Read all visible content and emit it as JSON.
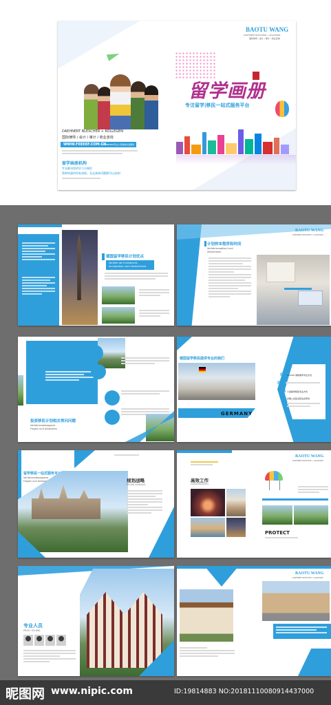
{
  "cover": {
    "brand": "BAOTU WANG",
    "brand_sub": "DAEHNERT BLESCHER + KOLLEGEN",
    "brand_tagline": "国际律师 / 会计 / 审计 / 商业咨询",
    "title": "留学画册",
    "subtitle": "专注留学|移民一站式服务平台",
    "company": "DAEHNERT BLESCHER + KOLLEGEN",
    "services": "国际律师 / 会计 / 审计 / 商业咨询",
    "url": "WWW.FEEEEF.COM.CN",
    "hotline": "400888888专业人员竭诚为您服务",
    "org_title": "留学画册机构",
    "org_line1": "专业解决您的学习与移民",
    "org_line2": "简单快速的所有流程，无论具体问题都可以咨询！"
  },
  "spread1": {
    "left_title": "德国留学移民计划优点",
    "left_sub1": "Vorteile der Investment-",
    "left_sub2": "Immigration nach Deutschland",
    "right_brand": "BAOTU WANG",
    "right_brand_sub": "DAEHNERT BLESCHER + KOLLEGEN",
    "right_title": "计划样本程序和时间",
    "right_sub1": "Verfahrensablauf und",
    "right_sub2": "Zeitrahmen"
  },
  "spread2": {
    "left_title": "投资移民计划相关常问问题",
    "left_sub1": "Verfahrensbezogene",
    "left_sub2": "Fragen und Antworten",
    "right_title": "德国留学移民提供专业的我们",
    "right_photo_label": "GERMANY",
    "step1": "01",
    "step2": "02",
    "step3": "03",
    "step4": "04",
    "step1_text": "SCOWS 我移留学专业方式",
    "step3_text": "介绍留学移民专业方式",
    "step4_text": "办理入境签证和住房申请"
  },
  "spread3": {
    "left_title": "留学移民一站式服务平台",
    "left_sub1": "Verfahrensbezogene",
    "left_sub2": "Fragen und Antworten",
    "mid_title": "规划战略",
    "mid_sub": "PFLAN ZAVIAUS",
    "brand": "BAOTU WANG",
    "brand_sub": "DAEHNERT BLESCHER + KOLLEGEN",
    "right_title": "高效工作",
    "right_sub": "SARAWISOGKEUS",
    "protect": "PROTECT"
  },
  "spread4": {
    "left_title": "专业人员",
    "left_sub": "PROFI YOUWA",
    "brand": "BAOTU WANG",
    "brand_sub": "DAEHNERT BLESCHER + KOLLEGEN"
  },
  "footer": {
    "logo": "昵图网",
    "site": "www.nipic.com",
    "id_text": "ID:19814883 NO:20181110080914437000"
  },
  "colors": {
    "accent": "#2f9fdc",
    "footer_bg": "#3a3a3a"
  }
}
